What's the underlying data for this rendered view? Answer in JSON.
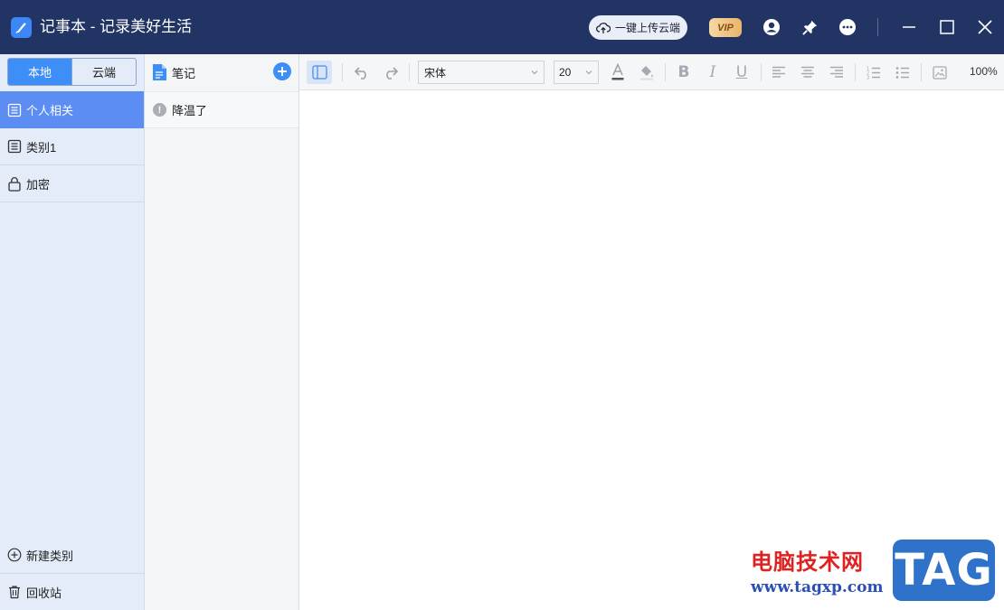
{
  "app": {
    "title": "记事本 - 记录美好生活",
    "upload_label": "一键上传云端",
    "vip_label": "VIP"
  },
  "sidebar": {
    "tabs": [
      {
        "label": "本地",
        "active": true
      },
      {
        "label": "云端",
        "active": false
      }
    ],
    "categories": [
      {
        "label": "个人相关",
        "icon": "list-icon",
        "active": true
      },
      {
        "label": "类别1",
        "icon": "list-icon",
        "active": false
      },
      {
        "label": "加密",
        "icon": "lock-icon",
        "active": false
      }
    ],
    "new_category_label": "新建类别",
    "recycle_label": "回收站"
  },
  "notelist": {
    "header": "笔记",
    "items": [
      {
        "title": "降温了",
        "status_icon": "warning-icon"
      }
    ]
  },
  "toolbar": {
    "font_family": "宋体",
    "font_size": "20",
    "zoom": "100%"
  },
  "watermark": {
    "site_name": "电脑技术网",
    "site_url": "www.tagxp.com",
    "logo_text": "TAG"
  },
  "colors": {
    "titlebar": "#223463",
    "accent": "#3e8ef7",
    "active_category": "#5c8df3",
    "sidebar_bg": "#e3ecf8"
  }
}
